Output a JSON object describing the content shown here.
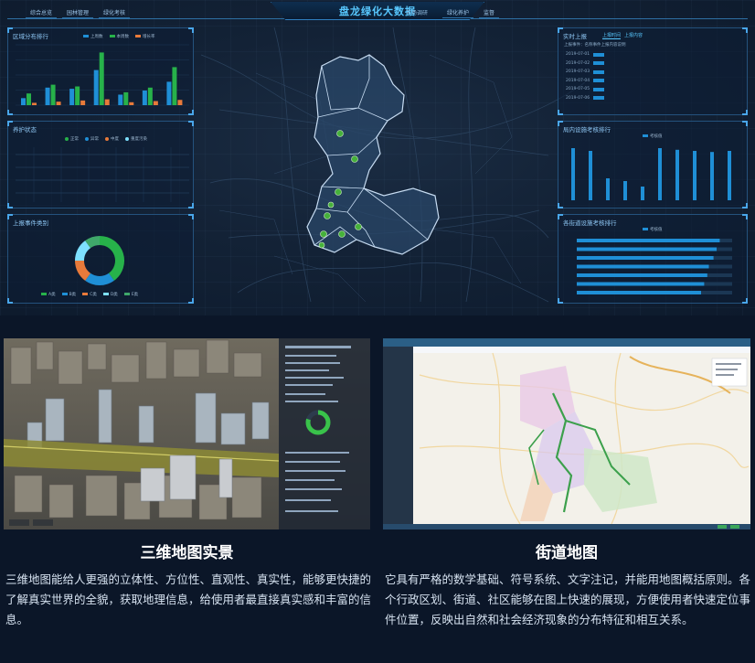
{
  "dashboard": {
    "title": "盘龙绿化大数据",
    "title_tag": "市场调研",
    "nav_left": [
      "综合总览",
      "园林管理",
      "绿化考核"
    ],
    "nav_right": [
      "绿化养护",
      "监督"
    ],
    "panels": {
      "left_top": {
        "title": "区域分布排行",
        "legend": [
          "上周数",
          "本周数",
          "增长率"
        ]
      },
      "left_mid": {
        "title": "养护状态",
        "legend": [
          "正常",
          "异常",
          "中度",
          "重度污染"
        ]
      },
      "left_bottom": {
        "title": "上报事件类别",
        "legend": [
          "A类",
          "B类",
          "C类",
          "D类",
          "E类"
        ]
      },
      "right_top": {
        "title": "实时上报",
        "tabs": [
          "上报时间",
          "上报内容"
        ],
        "header_line": "上报事件：名称事件上报内容说明",
        "rows": [
          "2019-07-01",
          "2019-07-02",
          "2019-07-03",
          "2019-07-04",
          "2019-07-05",
          "2019-07-06"
        ]
      },
      "right_mid": {
        "title": "局内设施考核排行",
        "legend": [
          "考核值"
        ]
      },
      "right_bottom": {
        "title": "各街道设施考核排行",
        "legend": [
          "考核值"
        ]
      }
    },
    "colors": {
      "accent": "#58c8ff",
      "bar_blue": "#1f8fd6",
      "bar_green": "#27b24a",
      "bar_orange": "#e87a3a"
    }
  },
  "chart_data": [
    {
      "type": "bar",
      "title": "区域分布排行",
      "categories": [
        "",
        "",
        "",
        "",
        "",
        "",
        ""
      ],
      "series": [
        {
          "name": "上周数",
          "values": [
            12,
            30,
            28,
            60,
            18,
            25,
            40
          ]
        },
        {
          "name": "本周数",
          "values": [
            20,
            35,
            32,
            90,
            22,
            30,
            65
          ]
        },
        {
          "name": "增长率",
          "values": [
            4,
            6,
            8,
            10,
            5,
            7,
            9
          ]
        }
      ]
    },
    {
      "type": "pie",
      "title": "上报事件类别",
      "labels": [
        "A类",
        "B类",
        "C类",
        "D类",
        "E类"
      ],
      "values": [
        40,
        20,
        15,
        15,
        10
      ]
    },
    {
      "type": "bar",
      "title": "局内设施考核排行",
      "categories": [
        "",
        "",
        "",
        "",
        "",
        "",
        "",
        "",
        "",
        ""
      ],
      "values": [
        95,
        90,
        40,
        35,
        25,
        95,
        92,
        90,
        88,
        90
      ]
    },
    {
      "type": "bar",
      "title": "各街道设施考核排行",
      "categories": [
        "",
        "",
        "",
        "",
        "",
        "",
        ""
      ],
      "values": [
        92,
        90,
        88,
        85,
        84,
        82,
        80
      ]
    }
  ],
  "cards": [
    {
      "title": "三维地图实景",
      "description": "三维地图能给人更强的立体性、方位性、直观性、真实性，能够更快捷的了解真实世界的全貌，获取地理信息，给使用者最直接真实感和丰富的信息。"
    },
    {
      "title": "街道地图",
      "description": "它具有严格的数学基础、符号系统、文字注记，并能用地图概括原则。各个行政区划、街道、社区能够在图上快速的展现，方便使用者快速定位事件位置，反映出自然和社会经济现象的分布特征和相互关系。"
    }
  ]
}
